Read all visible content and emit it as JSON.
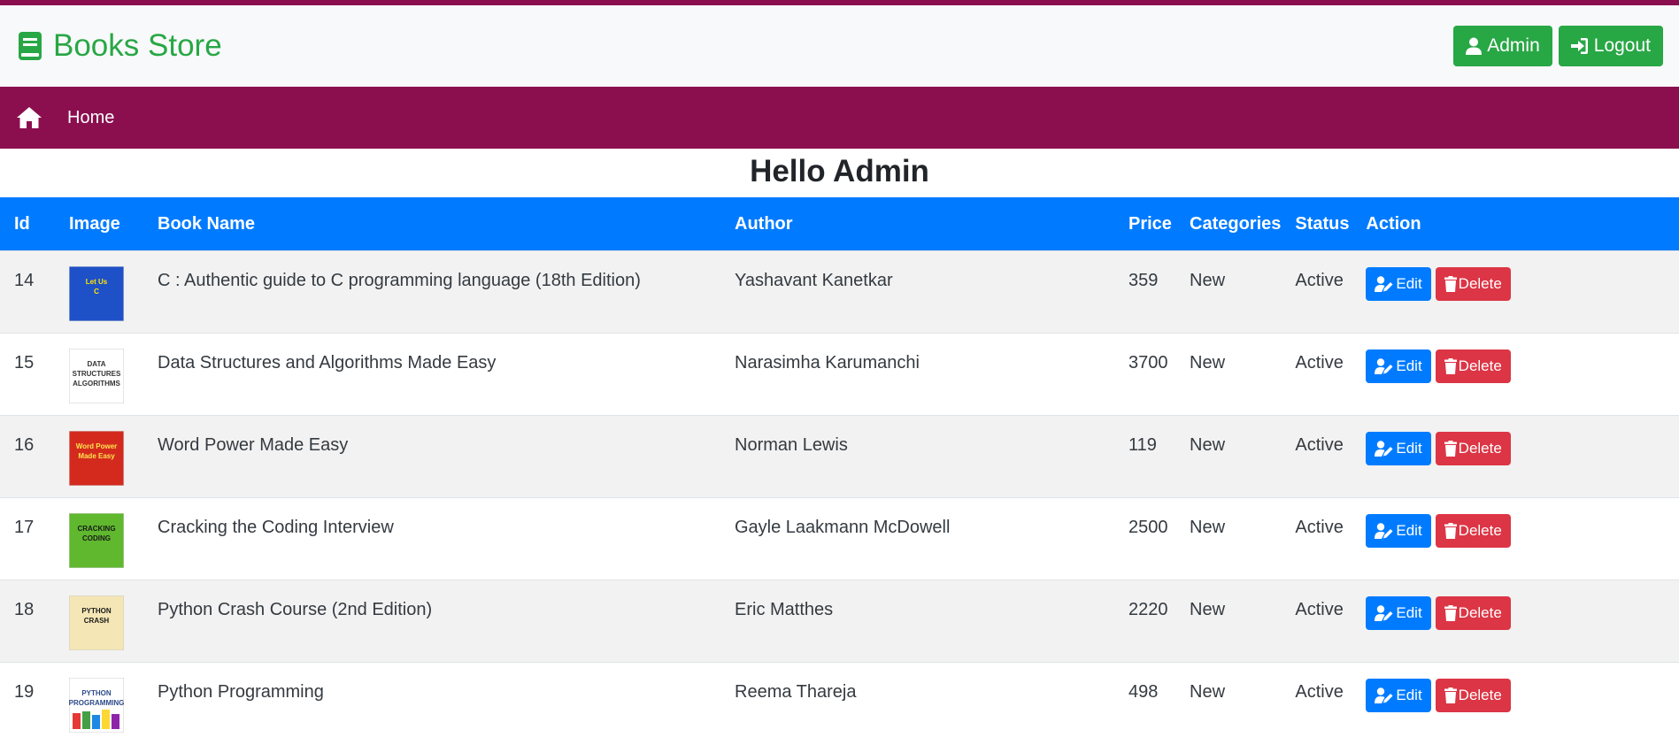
{
  "brand": {
    "title": "Books Store",
    "color": "#28a745"
  },
  "header": {
    "admin_label": "Admin",
    "logout_label": "Logout"
  },
  "nav": {
    "home_label": "Home"
  },
  "greeting": "Hello Admin",
  "table": {
    "columns": [
      "Id",
      "Image",
      "Book Name",
      "Author",
      "Price",
      "Categories",
      "Status",
      "Action"
    ],
    "rows": [
      {
        "id": "14",
        "name": "C : Authentic guide to C programming language (18th Edition)",
        "author": "Yashavant Kanetkar",
        "price": "359",
        "category": "New",
        "status": "Active",
        "cover_title": "Let Us C"
      },
      {
        "id": "15",
        "name": "Data Structures and Algorithms Made Easy",
        "author": "Narasimha Karumanchi",
        "price": "3700",
        "category": "New",
        "status": "Active",
        "cover_title": "DATA STRUCTURES AND ALGORITHMS MADE EASY"
      },
      {
        "id": "16",
        "name": "Word Power Made Easy",
        "author": "Norman Lewis",
        "price": "119",
        "category": "New",
        "status": "Active",
        "cover_title": "Word Power Made Easy"
      },
      {
        "id": "17",
        "name": "Cracking the Coding Interview",
        "author": "Gayle Laakmann McDowell",
        "price": "2500",
        "category": "New",
        "status": "Active",
        "cover_title": "CRACKING the CODING INTERVIEW"
      },
      {
        "id": "18",
        "name": "Python Crash Course (2nd Edition)",
        "author": "Eric Matthes",
        "price": "2220",
        "category": "New",
        "status": "Active",
        "cover_title": "PYTHON CRASH COURSE"
      },
      {
        "id": "19",
        "name": "Python Programming",
        "author": "Reema Thareja",
        "price": "498",
        "category": "New",
        "status": "Active",
        "cover_title": "PYTHON PROGRAMMING"
      }
    ],
    "edit_label": "Edit",
    "delete_label": "Delete"
  },
  "colors": {
    "nav": "#8b0f4f",
    "header_row": "#007bff",
    "edit": "#007bff",
    "delete": "#dc3545"
  },
  "icons": [
    "book-icon",
    "user-icon",
    "sign-in-icon",
    "home-icon",
    "user-edit-icon",
    "trash-icon"
  ]
}
